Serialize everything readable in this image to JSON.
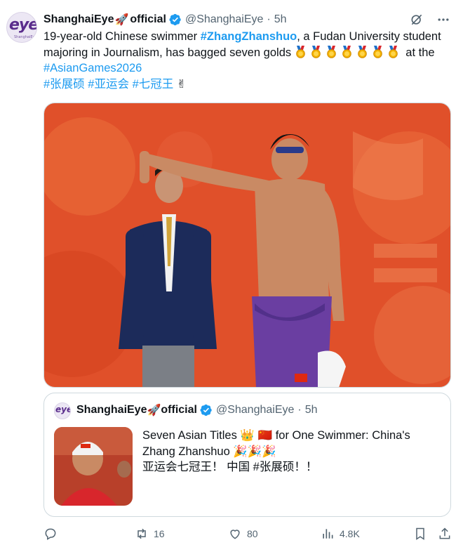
{
  "tweet": {
    "author_name": "ShanghaiEye",
    "author_suffix": "official",
    "handle": "@ShanghaiEye",
    "separator": "·",
    "time": "5h",
    "avatar_text": "eye",
    "avatar_subtext": "ShanghaiEye",
    "text": {
      "part1": "19-year-old Chinese swimmer ",
      "tag1": "#ZhangZhanshuo",
      "part2": ", a Fudan University student majoring in Journalism, has bagged seven golds ",
      "part3": " at the ",
      "tag2": "#AsianGames2026",
      "tag3": "#张展硕",
      "tag4": "#亚运会",
      "tag5": "#七冠王",
      "emoji_victory": "✌"
    },
    "medal_count": 7
  },
  "quote": {
    "author_name": "ShanghaiEye",
    "author_suffix": "official",
    "handle": "@ShanghaiEye",
    "separator": "·",
    "time": "5h",
    "avatar_text": "eye",
    "line1_a": "Seven Asian Titles ",
    "line1_b": " for One Swimmer: China's Zhang Zhanshuo ",
    "emoji_party": "🎉🎉🎉",
    "line2_a": "亚运会七冠王！ 中国 ",
    "line2_tag": "#张展硕",
    "line2_b": "！！"
  },
  "actions": {
    "replies": "",
    "retweets": "16",
    "likes": "80",
    "views": "4.8K"
  },
  "colors": {
    "link": "#1d9bf0",
    "muted": "#536471",
    "verified": "#1d9bf0",
    "media_bg": "#e0502a"
  },
  "icons": [
    "verified-badge-icon",
    "grok-icon",
    "more-icon",
    "reply-icon",
    "retweet-icon",
    "like-icon",
    "views-icon",
    "bookmark-icon",
    "share-icon",
    "rocket-icon",
    "medal-icon",
    "crown-icon",
    "china-flag-icon"
  ]
}
